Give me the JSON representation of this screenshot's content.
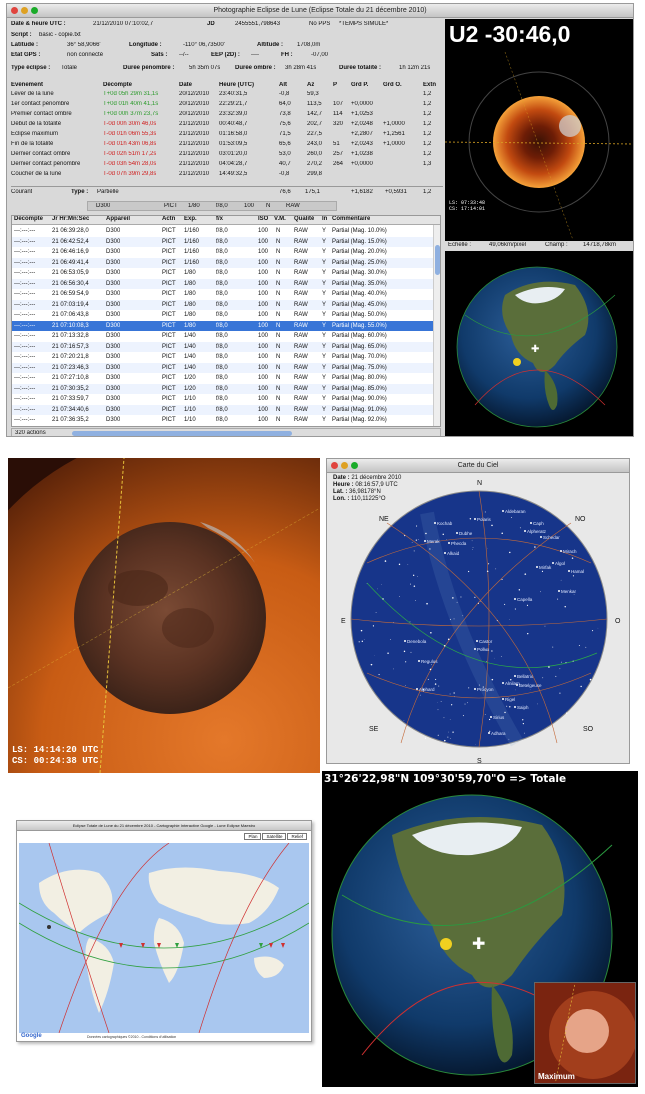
{
  "app": {
    "title": "Photographie Eclipse de Lune (Eclipse Totale du 21 décembre 2010)",
    "header": {
      "r1": {
        "dt_label": "Date & heure UTC :",
        "dt_value": "21/12/2010     07:10:02,7",
        "jd_label": "JD",
        "jd_value": "2455551,798643",
        "pps": "No PPS",
        "sim": "*TEMPS SIMULE*"
      },
      "r2": {
        "script_label": "Script :",
        "script_value": "basic - copie.txt"
      },
      "r3": {
        "lat_label": "Latitude :",
        "lat_value": "36° 58,9066'",
        "lon_label": "Longitude :",
        "lon_value": "-110° 06,73500'",
        "alt_label": "Altitude :",
        "alt_value": "1708,0m"
      },
      "r4": {
        "gps_label": "Etat GPS :",
        "gps_value": "non connecté",
        "sats_label": "Sats :",
        "sats_value": "--/--",
        "eep_label": "EEP (2D) :",
        "eep_value": "----",
        "fh_label": "FH :",
        "fh_value": "-07,00"
      },
      "r5": {
        "type_label": "Type éclipse :",
        "type_value": "Totale",
        "pen_label": "Durée pénombre :",
        "pen_value": "5h 35m 07s",
        "omb_label": "Durée ombre :",
        "omb_value": "3h 28m 41s",
        "tot_label": "Durée totalité :",
        "tot_value": "1h 12m 21s"
      }
    },
    "events_header": [
      "Evénement",
      "Décompte",
      "Date",
      "Heure (UTC)",
      "Alt",
      "Az",
      "P",
      "Grd P.",
      "Grd O.",
      "Extn"
    ],
    "events": [
      {
        "name": "Lever de la lune",
        "count": "T+0d 05h 29m 31,1s",
        "color": "green",
        "date": "20/12/2010",
        "time": "23:40:31,5",
        "alt": "-0,8",
        "az": "59,3",
        "p": "",
        "gp": "",
        "go": "",
        "ext": "1,2"
      },
      {
        "name": "1er contact pénombre",
        "count": "T+0d 01h 40m 41,1s",
        "color": "green",
        "date": "20/12/2010",
        "time": "22:29:21,7",
        "alt": "64,0",
        "az": "113,5",
        "p": "107",
        "gp": "+0,0000",
        "go": "",
        "ext": "1,2"
      },
      {
        "name": "Premier contact ombre",
        "count": "T+0d 00h 37m 23,7s",
        "color": "green",
        "date": "20/12/2010",
        "time": "23:32:39,0",
        "alt": "73,8",
        "az": "142,7",
        "p": "114",
        "gp": "+1,0253",
        "go": "",
        "ext": "1,2"
      },
      {
        "name": "Début de la totalité",
        "count": "T-0d 00h 30m 46,0s",
        "color": "red",
        "date": "21/12/2010",
        "time": "00:40:48,7",
        "alt": "75,6",
        "az": "202,7",
        "p": "320",
        "gp": "+2,0248",
        "go": "+1,0000",
        "ext": "1,2"
      },
      {
        "name": "Eclipse maximum",
        "count": "T-0d 01h 06m 55,3s",
        "color": "red",
        "date": "21/12/2010",
        "time": "01:16:58,0",
        "alt": "71,5",
        "az": "227,5",
        "p": "",
        "gp": "+2,2807",
        "go": "+1,2561",
        "ext": "1,2"
      },
      {
        "name": "Fin de la totalité",
        "count": "T-0d 01h 43m 06,8s",
        "color": "red",
        "date": "21/12/2010",
        "time": "01:53:09,5",
        "alt": "65,6",
        "az": "243,0",
        "p": "51",
        "gp": "+2,0243",
        "go": "+1,0000",
        "ext": "1,2"
      },
      {
        "name": "Dernier contact ombre",
        "count": "T-0d 02h 51m 17,2s",
        "color": "red",
        "date": "21/12/2010",
        "time": "03:01:20,0",
        "alt": "53,0",
        "az": "260,0",
        "p": "257",
        "gp": "+1,0238",
        "go": "",
        "ext": "1,2"
      },
      {
        "name": "Dernier contact pénombre",
        "count": "T-0d 03h 54m 28,0s",
        "color": "red",
        "date": "21/12/2010",
        "time": "04:04:28,7",
        "alt": "40,7",
        "az": "270,2",
        "p": "264",
        "gp": "+0,0000",
        "go": "",
        "ext": "1,3"
      },
      {
        "name": "Coucher de la lune",
        "count": "T-0d 07h 39m 29,8s",
        "color": "red",
        "date": "21/12/2010",
        "time": "14:49:32,5",
        "alt": "-0,8",
        "az": "299,8",
        "p": "",
        "gp": "",
        "go": "",
        "ext": ""
      }
    ],
    "current": {
      "label": "Courant",
      "type_label": "Type :",
      "type_value": "Partielle",
      "alt": "76,6",
      "az": "175,1",
      "gp": "+1,6182",
      "go": "+0,5931",
      "ext": "1,2"
    },
    "camera": [
      "D300",
      "PICT",
      "1/80",
      "f/8,0",
      "100",
      "N",
      "RAW"
    ],
    "table_header": [
      "Décompte",
      "Jr Hr:Mn:Sec",
      "Appareil",
      "Actn",
      "Exp.",
      "f/x",
      "ISO",
      "V.M.",
      "Qualité",
      "In",
      "Commentaire"
    ],
    "rows": [
      {
        "c": "---:---:---",
        "t": "21 06:39:28,0",
        "a": "D300",
        "ac": "PICT",
        "e": "1/160",
        "f": "f/8,0",
        "i": "100",
        "v": "N",
        "q": "RAW",
        "in": "Y",
        "cm": "Partial (Mag. 10.0%)"
      },
      {
        "c": "---:---:---",
        "t": "21 06:42:52,4",
        "a": "D300",
        "ac": "PICT",
        "e": "1/160",
        "f": "f/8,0",
        "i": "100",
        "v": "N",
        "q": "RAW",
        "in": "Y",
        "cm": "Partial (Mag. 15.0%)"
      },
      {
        "c": "---:---:---",
        "t": "21 06:46:16,9",
        "a": "D300",
        "ac": "PICT",
        "e": "1/160",
        "f": "f/8,0",
        "i": "100",
        "v": "N",
        "q": "RAW",
        "in": "Y",
        "cm": "Partial (Mag. 20.0%)"
      },
      {
        "c": "---:---:---",
        "t": "21 06:49:41,4",
        "a": "D300",
        "ac": "PICT",
        "e": "1/160",
        "f": "f/8,0",
        "i": "100",
        "v": "N",
        "q": "RAW",
        "in": "Y",
        "cm": "Partial (Mag. 25.0%)"
      },
      {
        "c": "---:---:---",
        "t": "21 06:53:05,9",
        "a": "D300",
        "ac": "PICT",
        "e": "1/80",
        "f": "f/8,0",
        "i": "100",
        "v": "N",
        "q": "RAW",
        "in": "Y",
        "cm": "Partial (Mag. 30.0%)"
      },
      {
        "c": "---:---:---",
        "t": "21 06:56:30,4",
        "a": "D300",
        "ac": "PICT",
        "e": "1/80",
        "f": "f/8,0",
        "i": "100",
        "v": "N",
        "q": "RAW",
        "in": "Y",
        "cm": "Partial (Mag. 35.0%)"
      },
      {
        "c": "---:---:---",
        "t": "21 06:59:54,9",
        "a": "D300",
        "ac": "PICT",
        "e": "1/80",
        "f": "f/8,0",
        "i": "100",
        "v": "N",
        "q": "RAW",
        "in": "Y",
        "cm": "Partial (Mag. 40.0%)"
      },
      {
        "c": "---:---:---",
        "t": "21 07:03:19,4",
        "a": "D300",
        "ac": "PICT",
        "e": "1/80",
        "f": "f/8,0",
        "i": "100",
        "v": "N",
        "q": "RAW",
        "in": "Y",
        "cm": "Partial (Mag. 45.0%)"
      },
      {
        "c": "---:---:---",
        "t": "21 07:06:43,8",
        "a": "D300",
        "ac": "PICT",
        "e": "1/80",
        "f": "f/8,0",
        "i": "100",
        "v": "N",
        "q": "RAW",
        "in": "Y",
        "cm": "Partial (Mag. 50.0%)"
      },
      {
        "c": "---:---:---",
        "t": "21 07:10:08,3",
        "a": "D300",
        "ac": "PICT",
        "e": "1/80",
        "f": "f/8,0",
        "i": "100",
        "v": "N",
        "q": "RAW",
        "in": "Y",
        "cm": "Partial (Mag. 55.0%)",
        "sel": true
      },
      {
        "c": "---:---:---",
        "t": "21 07:13:32,8",
        "a": "D300",
        "ac": "PICT",
        "e": "1/40",
        "f": "f/8,0",
        "i": "100",
        "v": "N",
        "q": "RAW",
        "in": "Y",
        "cm": "Partial (Mag. 60.0%)"
      },
      {
        "c": "---:---:---",
        "t": "21 07:16:57,3",
        "a": "D300",
        "ac": "PICT",
        "e": "1/40",
        "f": "f/8,0",
        "i": "100",
        "v": "N",
        "q": "RAW",
        "in": "Y",
        "cm": "Partial (Mag. 65.0%)"
      },
      {
        "c": "---:---:---",
        "t": "21 07:20:21,8",
        "a": "D300",
        "ac": "PICT",
        "e": "1/40",
        "f": "f/8,0",
        "i": "100",
        "v": "N",
        "q": "RAW",
        "in": "Y",
        "cm": "Partial (Mag. 70.0%)"
      },
      {
        "c": "---:---:---",
        "t": "21 07:23:46,3",
        "a": "D300",
        "ac": "PICT",
        "e": "1/40",
        "f": "f/8,0",
        "i": "100",
        "v": "N",
        "q": "RAW",
        "in": "Y",
        "cm": "Partial (Mag. 75.0%)"
      },
      {
        "c": "---:---:---",
        "t": "21 07:27:10,8",
        "a": "D300",
        "ac": "PICT",
        "e": "1/20",
        "f": "f/8,0",
        "i": "100",
        "v": "N",
        "q": "RAW",
        "in": "Y",
        "cm": "Partial (Mag. 80.0%)"
      },
      {
        "c": "---:---:---",
        "t": "21 07:30:35,2",
        "a": "D300",
        "ac": "PICT",
        "e": "1/20",
        "f": "f/8,0",
        "i": "100",
        "v": "N",
        "q": "RAW",
        "in": "Y",
        "cm": "Partial (Mag. 85.0%)"
      },
      {
        "c": "---:---:---",
        "t": "21 07:33:59,7",
        "a": "D300",
        "ac": "PICT",
        "e": "1/10",
        "f": "f/8,0",
        "i": "100",
        "v": "N",
        "q": "RAW",
        "in": "Y",
        "cm": "Partial (Mag. 90.0%)"
      },
      {
        "c": "---:---:---",
        "t": "21 07:34:40,6",
        "a": "D300",
        "ac": "PICT",
        "e": "1/10",
        "f": "f/8,0",
        "i": "100",
        "v": "N",
        "q": "RAW",
        "in": "Y",
        "cm": "Partial (Mag. 91.0%)"
      },
      {
        "c": "---:---:---",
        "t": "21 07:36:35,2",
        "a": "D300",
        "ac": "PICT",
        "e": "1/10",
        "f": "f/8,0",
        "i": "100",
        "v": "N",
        "q": "RAW",
        "in": "Y",
        "cm": "Partial (Mag. 92.0%)"
      }
    ],
    "actions_count": "320 actions",
    "countdown": "U2 -30:46,0",
    "ls_small": "LS: 07:33:48",
    "cs_small": "CS: 17:14:01",
    "scale_label": "Echelle :",
    "scale_value": "49,06km/pixel",
    "field_label": "Champ :",
    "field_value": "14718,78km"
  },
  "moon_photo": {
    "ls": "LS: 14:14:20 UTC",
    "cs": "CS: 00:24:38 UTC"
  },
  "sky": {
    "title": "Carte du Ciel",
    "date_label": "Date :",
    "date_value": "21 décembre 2010",
    "time_label": "Heure :",
    "time_value": "08:16:57,9 UTC",
    "lat_label": "Lat. :",
    "lat_value": "36,98178°N",
    "lon_label": "Lon. :",
    "lon_value": "110,11225°O",
    "dirs": {
      "n": "N",
      "ne": "NE",
      "no": "NO",
      "e": "E",
      "o": "O",
      "se": "SE",
      "so": "SO",
      "s": "S"
    },
    "stars": [
      "Aldebaran",
      "Capella",
      "Polaris",
      "Kochab",
      "Alphard",
      "Regulus",
      "Procyon",
      "Sirius",
      "Rigel",
      "Betelgeuse",
      "Castor",
      "Pollux",
      "Denebola",
      "Mirach",
      "Alpheratz",
      "Hamal",
      "Mirfak",
      "Menkar",
      "Alkaid",
      "Phecda",
      "Merak",
      "Dubhe",
      "Bellatrix",
      "Saiph",
      "Adhara",
      "Alnilam",
      "Schedar",
      "Algol",
      "Caph"
    ]
  },
  "map": {
    "title": "Eclipse Totale de Lune du 21 décembre 2010 - Cartographie Interactive Google - Lune Eclipse Maestro",
    "btn1": "Plan",
    "btn2": "Satellite",
    "btn3": "Relief",
    "credit": "Données cartographiques ©2010 - Conditions d'utilisation"
  },
  "globe2": {
    "coords": "31°26'22,98\"N  109°30'59,70\"O => Totale",
    "inset": "Maximum"
  }
}
